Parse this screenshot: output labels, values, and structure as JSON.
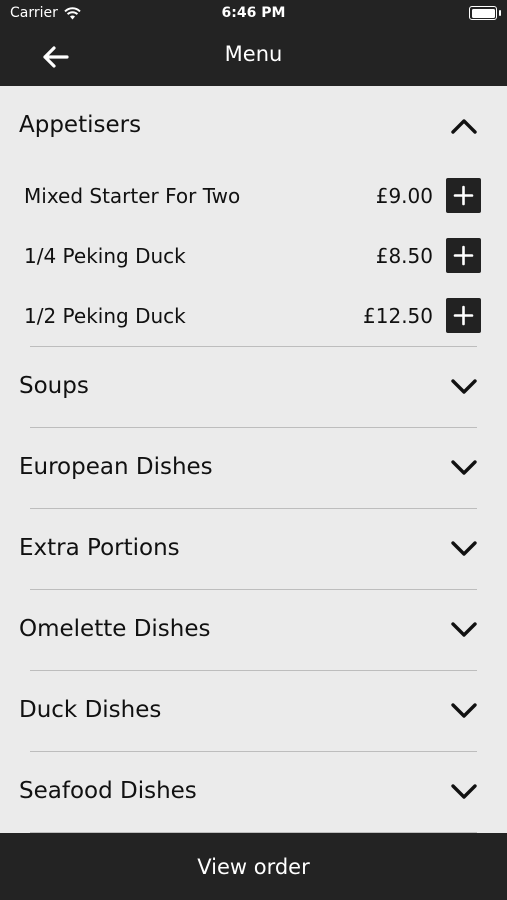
{
  "status_bar": {
    "carrier": "Carrier",
    "time": "6:46 PM"
  },
  "nav": {
    "title": "Menu",
    "back_icon": "arrow-left-icon"
  },
  "categories": [
    {
      "name": "Appetisers",
      "expanded": true,
      "items": [
        {
          "name": "Mixed Starter For Two",
          "price": "£9.00"
        },
        {
          "name": "1/4 Peking Duck",
          "price": "£8.50"
        },
        {
          "name": "1/2 Peking Duck",
          "price": "£12.50"
        }
      ]
    },
    {
      "name": "Soups",
      "expanded": false
    },
    {
      "name": "European Dishes",
      "expanded": false
    },
    {
      "name": "Extra Portions",
      "expanded": false
    },
    {
      "name": "Omelette Dishes",
      "expanded": false
    },
    {
      "name": "Duck Dishes",
      "expanded": false
    },
    {
      "name": "Seafood Dishes",
      "expanded": false
    }
  ],
  "bottom": {
    "label": "View order"
  },
  "colors": {
    "bar": "#232323",
    "background": "#ebebeb",
    "text": "#111111",
    "divider": "#bdbdbd"
  }
}
